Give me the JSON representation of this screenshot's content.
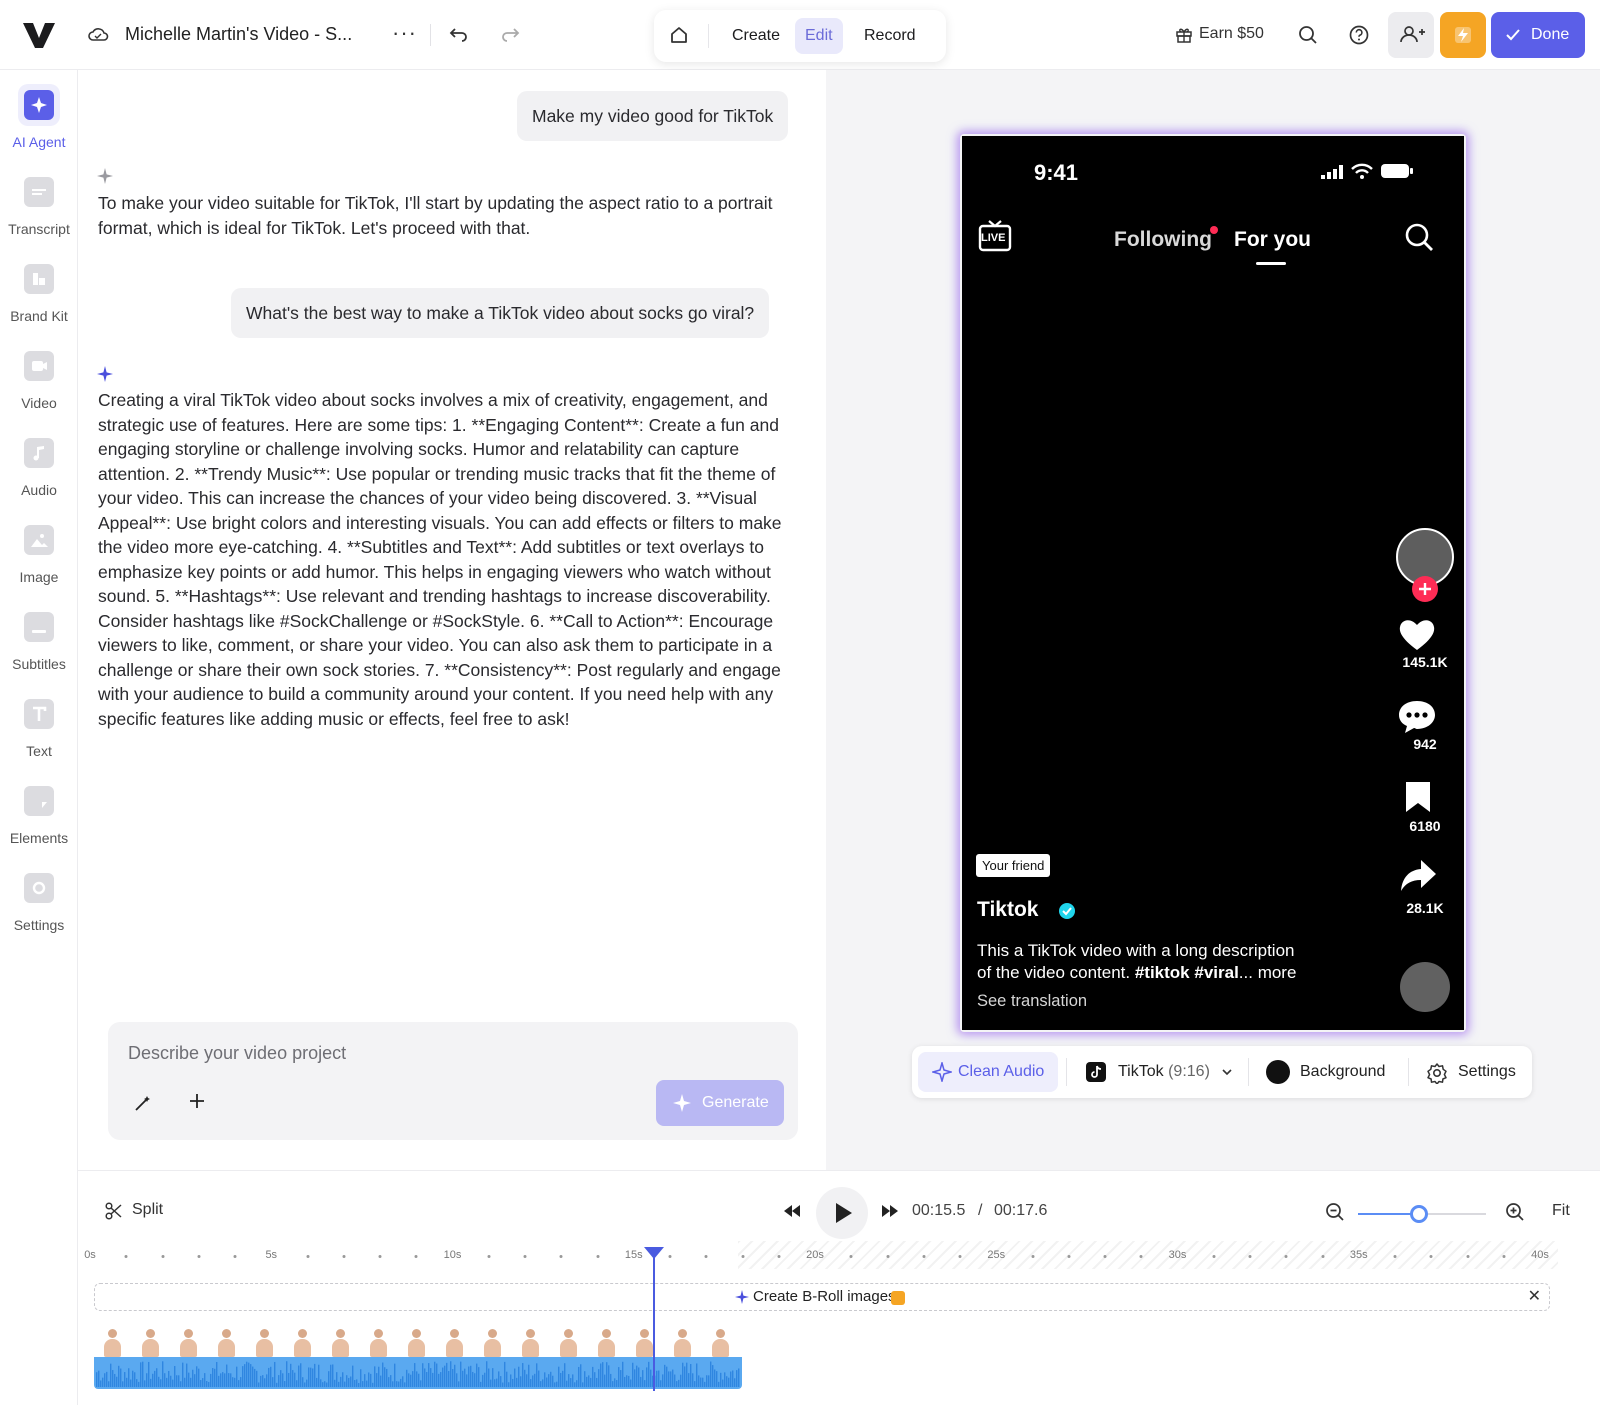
{
  "topbar": {
    "project_title": "Michelle Martin's Video - S...",
    "more_label": "···",
    "modes": [
      {
        "label": "Create",
        "active": false
      },
      {
        "label": "Edit",
        "active": true
      },
      {
        "label": "Record",
        "active": false
      }
    ],
    "earn_label": "Earn $50",
    "done_label": "Done",
    "accent": "#5b5fe8",
    "bolt_color": "#f5a524"
  },
  "rail": {
    "items": [
      {
        "label": "AI Agent",
        "icon": "ai-agent-icon",
        "active": true
      },
      {
        "label": "Transcript",
        "icon": "transcript-icon",
        "active": false
      },
      {
        "label": "Brand Kit",
        "icon": "brand-kit-icon",
        "active": false
      },
      {
        "label": "Video",
        "icon": "video-icon",
        "active": false
      },
      {
        "label": "Audio",
        "icon": "audio-icon",
        "active": false
      },
      {
        "label": "Image",
        "icon": "image-icon",
        "active": false
      },
      {
        "label": "Subtitles",
        "icon": "subtitles-icon",
        "active": false
      },
      {
        "label": "Text",
        "icon": "text-icon",
        "active": false
      },
      {
        "label": "Elements",
        "icon": "elements-icon",
        "active": false
      },
      {
        "label": "Settings",
        "icon": "settings-icon",
        "active": false
      }
    ]
  },
  "chat": {
    "user_msg_1": "Make my video good for TikTok",
    "ai_msg_1": "To make your video suitable for TikTok, I'll start by updating the aspect ratio to a portrait format, which is ideal for TikTok. Let's proceed with that.",
    "user_msg_2": "What's the best way to make a TikTok video about socks go viral?",
    "ai_msg_2": "Creating a viral TikTok video about socks involves a mix of creativity, engagement, and strategic use of features. Here are some tips: 1. **Engaging Content**: Create a fun and engaging storyline or challenge involving socks. Humor and relatability can capture attention. 2. **Trendy Music**: Use popular or trending music tracks that fit the theme of your video. This can increase the chances of your video being discovered. 3. **Visual Appeal**: Use bright colors and interesting visuals. You can add effects or filters to make the video more eye-catching. 4. **Subtitles and Text**: Add subtitles or text overlays to emphasize key points or add humor. This helps in engaging viewers who watch without sound. 5. **Hashtags**: Use relevant and trending hashtags to increase discoverability. Consider hashtags like #SockChallenge or #SockStyle. 6. **Call to Action**: Encourage viewers to like, comment, or share your video. You can also ask them to participate in a challenge or share their own sock stories. 7. **Consistency**: Post regularly and engage with your audience to build a community around your content. If you need help with any specific features like adding music or effects, feel free to ask!",
    "prompt_placeholder": "Describe your video project",
    "generate_label": "Generate"
  },
  "phone": {
    "time": "9:41",
    "live_label": "LIVE",
    "tab_following": "Following",
    "tab_for_you": "For you",
    "likes": "145.1K",
    "comments": "942",
    "saves": "6180",
    "shares": "28.1K",
    "friend_tag": "Your friend",
    "username": "Tiktok",
    "description_line1": "This a TikTok video with a long description",
    "description_line2_plain": "of the video content. ",
    "description_hashtags": "#tiktok #viral",
    "description_more": "... more",
    "see_translation": "See translation"
  },
  "preview_toolbar": {
    "clean_audio": "Clean Audio",
    "format": "TikTok",
    "format_ratio": "(9:16)",
    "background": "Background",
    "settings": "Settings"
  },
  "timeline": {
    "split_label": "Split",
    "current_time": "00:15.5",
    "time_separator": "/",
    "total_time": "00:17.6",
    "zoom_level": 0.5,
    "fit_label": "Fit",
    "ruler_labels": [
      "0s",
      "5s",
      "10s",
      "15s",
      "20s",
      "25s",
      "30s",
      "35s",
      "40s"
    ],
    "broll_label": "Create B-Roll images",
    "broll_close": "✕",
    "playhead_seconds": 15.5,
    "clip_color": "#5aa9f0"
  }
}
